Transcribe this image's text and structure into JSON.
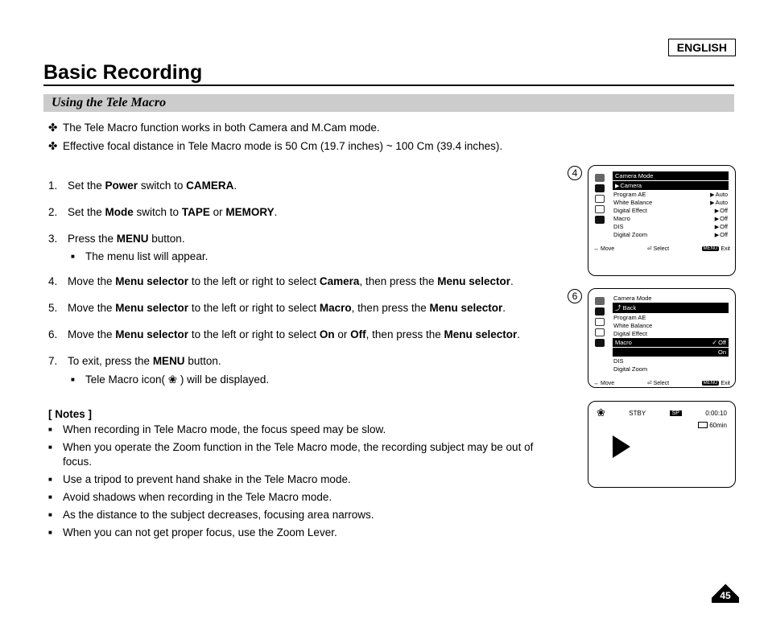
{
  "language": "ENGLISH",
  "title": "Basic Recording",
  "section": "Using the Tele Macro",
  "intro": [
    "The Tele Macro function works in both Camera and M.Cam mode.",
    "Effective focal distance in Tele Macro mode is 50 Cm (19.7 inches) ~ 100 Cm (39.4 inches)."
  ],
  "steps": [
    {
      "n": "1.",
      "html": "Set the <b>Power</b> switch to <b>CAMERA</b>."
    },
    {
      "n": "2.",
      "html": "Set the <b>Mode</b> switch to <b>TAPE</b> or <b>MEMORY</b>."
    },
    {
      "n": "3.",
      "html": "Press the <b>MENU</b> button.",
      "sub": "The menu list will appear."
    },
    {
      "n": "4.",
      "html": "Move the <b>Menu selector</b> to the left or right to select <b>Camera</b>, then press the <b>Menu selector</b>."
    },
    {
      "n": "5.",
      "html": "Move the <b>Menu selector</b> to the left or right to select <b>Macro</b>, then press the <b>Menu selector</b>."
    },
    {
      "n": "6.",
      "html": "Move the <b>Menu selector</b> to the left or right to select <b>On</b> or <b>Off</b>, then press the <b>Menu selector</b>."
    },
    {
      "n": "7.",
      "html": "To exit, press the <b>MENU</b> button.",
      "sub": "Tele Macro icon( ❀ ) will be displayed."
    }
  ],
  "notes_title": "[ Notes ]",
  "notes": [
    "When recording in Tele Macro mode, the focus speed may be slow.",
    "When you operate the Zoom function in the Tele Macro mode, the recording subject may be out of focus.",
    "Use a tripod to prevent hand shake in the Tele Macro mode.",
    "Avoid shadows when recording in the Tele Macro mode.",
    "As the distance to the subject decreases, focusing area narrows.",
    "When you can not get proper focus, use the Zoom Lever."
  ],
  "panel4": {
    "num": "4",
    "header": "Camera Mode",
    "camera_label": "Camera",
    "items": [
      {
        "label": "Program AE",
        "val": "Auto"
      },
      {
        "label": "White Balance",
        "val": "Auto"
      },
      {
        "label": "Digital Effect",
        "val": "Off"
      },
      {
        "label": "Macro",
        "val": "Off"
      },
      {
        "label": "DIS",
        "val": "Off"
      },
      {
        "label": "Digital Zoom",
        "val": "Off"
      }
    ],
    "nav": {
      "move": "Move",
      "select": "Select",
      "menu": "MENU",
      "exit": "Exit"
    }
  },
  "panel6": {
    "num": "6",
    "header": "Camera Mode",
    "back": "Back",
    "items_plain": [
      "Program AE",
      "White Balance",
      "Digital Effect"
    ],
    "macro": {
      "label": "Macro",
      "off": "Off",
      "on": "On"
    },
    "items_after": [
      "DIS",
      "Digital Zoom"
    ],
    "nav": {
      "move": "Move",
      "select": "Select",
      "menu": "MENU",
      "exit": "Exit"
    }
  },
  "panel7": {
    "stby": "STBY",
    "sp": "SP",
    "time": "0:00:10",
    "remain": "60min"
  },
  "page_number": "45"
}
